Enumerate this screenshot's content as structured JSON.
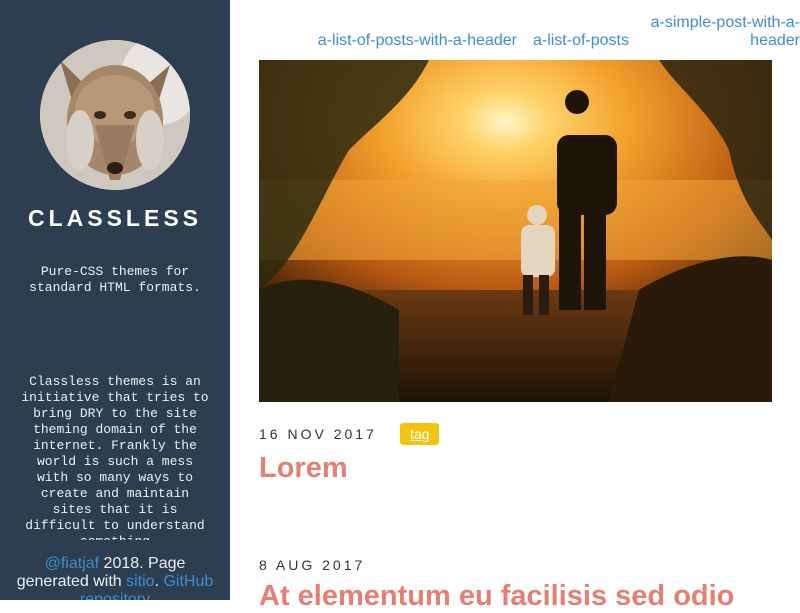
{
  "sidebar": {
    "title": "CLASSLESS",
    "tagline": "Pure-CSS themes for standard HTML formats.",
    "about": "Classless themes is an initiative that tries to bring DRY to the site theming domain of the internet. Frankly the world is such a mess with so many ways to create and maintain sites that it is difficult to understand something",
    "footer": {
      "author_link": "@fiatjaf",
      "text_1": " 2018. Page generated with ",
      "generator_link": "sitio",
      "text_2": ". ",
      "repo_link": "GitHub repository"
    }
  },
  "nav": {
    "items": [
      "a-list-of-posts-with-a-header",
      "a-list-of-posts",
      "a-simple-post-with-a-header"
    ]
  },
  "posts": [
    {
      "date": "16 NOV 2017",
      "tag": "tag",
      "title": "Lorem"
    },
    {
      "date": "8 AUG 2017",
      "title": "At elementum eu facilisis sed odio"
    }
  ],
  "colors": {
    "sidebar_bg": "#2c3e50",
    "link": "#3f8ccf",
    "post_title": "#e67e73",
    "tag_bg": "#f1c40f"
  }
}
